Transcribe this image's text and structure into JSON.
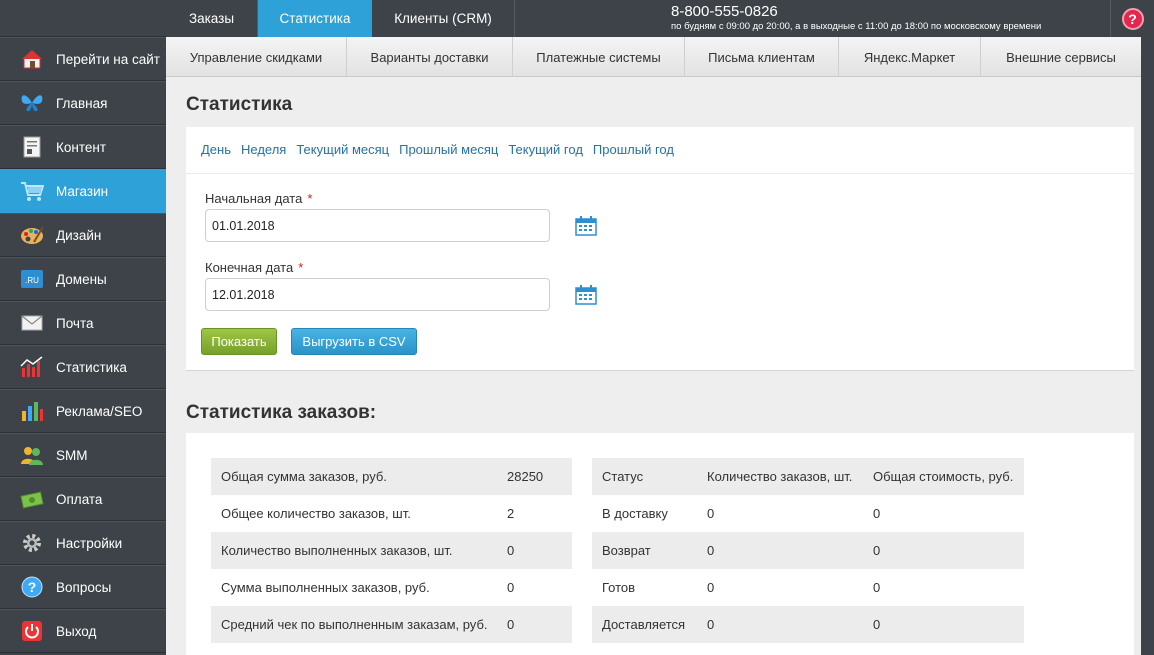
{
  "topnav": {
    "tabs": [
      {
        "label": "Заказы"
      },
      {
        "label": "Статистика"
      },
      {
        "label": "Клиенты (CRM)"
      }
    ],
    "phone": "8-800-555-0826",
    "hours": "по будням с 09:00 до 20:00, а в выходные с 11:00 до 18:00 по московскому времени",
    "help": "?"
  },
  "subnav": {
    "items": [
      {
        "label": "Управление скидками"
      },
      {
        "label": "Варианты доставки"
      },
      {
        "label": "Платежные системы"
      },
      {
        "label": "Письма клиентам"
      },
      {
        "label": "Яндекс.Маркет"
      },
      {
        "label": "Внешние сервисы"
      }
    ]
  },
  "sidebar": {
    "items": [
      {
        "label": "Перейти на сайт",
        "icon": "home-icon"
      },
      {
        "label": "Главная",
        "icon": "butterfly-icon"
      },
      {
        "label": "Контент",
        "icon": "document-icon"
      },
      {
        "label": "Магазин",
        "icon": "cart-icon"
      },
      {
        "label": "Дизайн",
        "icon": "palette-icon"
      },
      {
        "label": "Домены",
        "icon": "domain-icon",
        "badge": ".RU"
      },
      {
        "label": "Почта",
        "icon": "mail-icon"
      },
      {
        "label": "Статистика",
        "icon": "chart-icon"
      },
      {
        "label": "Реклама/SEO",
        "icon": "bars-icon"
      },
      {
        "label": "SMM",
        "icon": "people-icon"
      },
      {
        "label": "Оплата",
        "icon": "money-icon"
      },
      {
        "label": "Настройки",
        "icon": "gear-icon"
      },
      {
        "label": "Вопросы",
        "icon": "question-icon"
      },
      {
        "label": "Выход",
        "icon": "power-icon"
      }
    ],
    "active_index": 3
  },
  "page": {
    "title": "Статистика",
    "periods": [
      "День",
      "Неделя",
      "Текущий месяц",
      "Прошлый месяц",
      "Текущий год",
      "Прошлый год"
    ],
    "start_label": "Начальная дата",
    "start_value": "01.01.2018",
    "end_label": "Конечная дата",
    "end_value": "12.01.2018",
    "required_mark": "*",
    "show_button": "Показать",
    "csv_button": "Выгрузить в CSV"
  },
  "orders": {
    "title": "Статистика заказов:",
    "summary": [
      {
        "label": "Общая сумма заказов, руб.",
        "value": "28250"
      },
      {
        "label": "Общее количество заказов, шт.",
        "value": "2"
      },
      {
        "label": "Количество выполненных заказов, шт.",
        "value": "0"
      },
      {
        "label": "Сумма выполненных заказов, руб.",
        "value": "0"
      },
      {
        "label": "Средний чек по выполненным заказам, руб.",
        "value": "0"
      }
    ],
    "status_headers": [
      "Статус",
      "Количество заказов, шт.",
      "Общая стоимость, руб."
    ],
    "status_rows": [
      {
        "status": "В доставку",
        "count": "0",
        "total": "0"
      },
      {
        "status": "Возврат",
        "count": "0",
        "total": "0"
      },
      {
        "status": "Готов",
        "count": "0",
        "total": "0"
      },
      {
        "status": "Доставляется",
        "count": "0",
        "total": "0"
      }
    ]
  },
  "colors": {
    "accent": "#2ea1d8",
    "sidebar_bg": "#3d4348",
    "show_button": "#8ab53a",
    "link": "#2472a9"
  }
}
